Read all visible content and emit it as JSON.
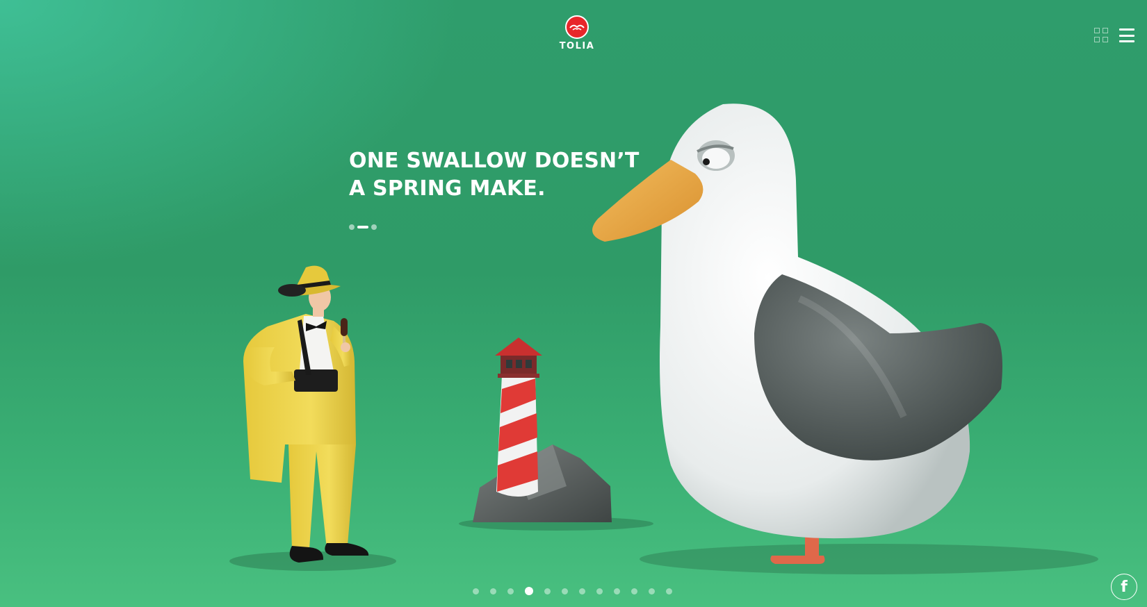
{
  "brand": {
    "name": "TOLIA",
    "logo_color": "#e8262a"
  },
  "header": {
    "icons": [
      "grid-view-icon",
      "menu-icon"
    ]
  },
  "hero": {
    "headline_line1": "ONE SWALLOW DOESN’T",
    "headline_line2": "A SPRING MAKE.",
    "text_slide_count": 3,
    "text_slide_active": 2
  },
  "pagination": {
    "total": 12,
    "active": 4
  },
  "social": {
    "facebook_label": "f"
  },
  "colors": {
    "background": "#2f9b67",
    "text": "#ffffff"
  }
}
